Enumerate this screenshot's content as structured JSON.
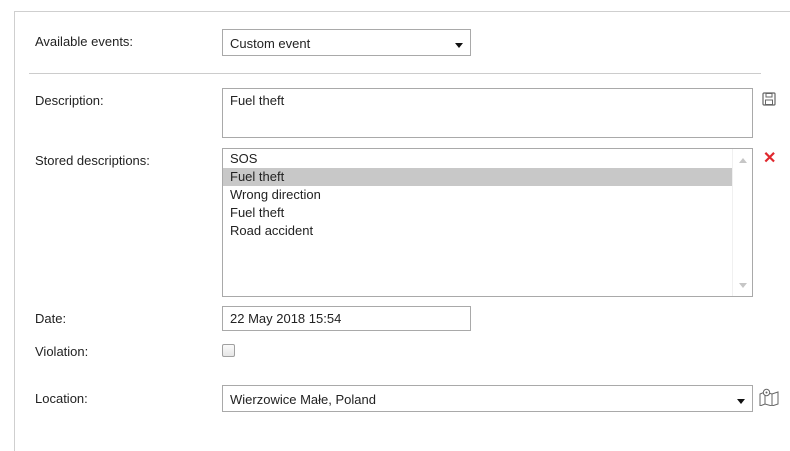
{
  "form": {
    "available_events": {
      "label": "Available events:",
      "value": "Custom event"
    },
    "description": {
      "label": "Description:",
      "value": "Fuel theft"
    },
    "stored_descriptions": {
      "label": "Stored descriptions:",
      "items": [
        "SOS",
        "Fuel theft",
        "Wrong direction",
        "Fuel theft",
        "Road accident"
      ],
      "selected_index": 1
    },
    "date": {
      "label": "Date:",
      "value": "22 May 2018 15:54"
    },
    "violation": {
      "label": "Violation:",
      "checked": false
    },
    "location": {
      "label": "Location:",
      "value": "Wierzowice Małe, Poland"
    }
  },
  "icons": {
    "save": "save-icon",
    "delete": "close-icon",
    "map": "map-icon"
  },
  "colors": {
    "selected_row": "#c8c8c8",
    "delete_red": "#e0282e",
    "border": "#a9a9a9"
  }
}
